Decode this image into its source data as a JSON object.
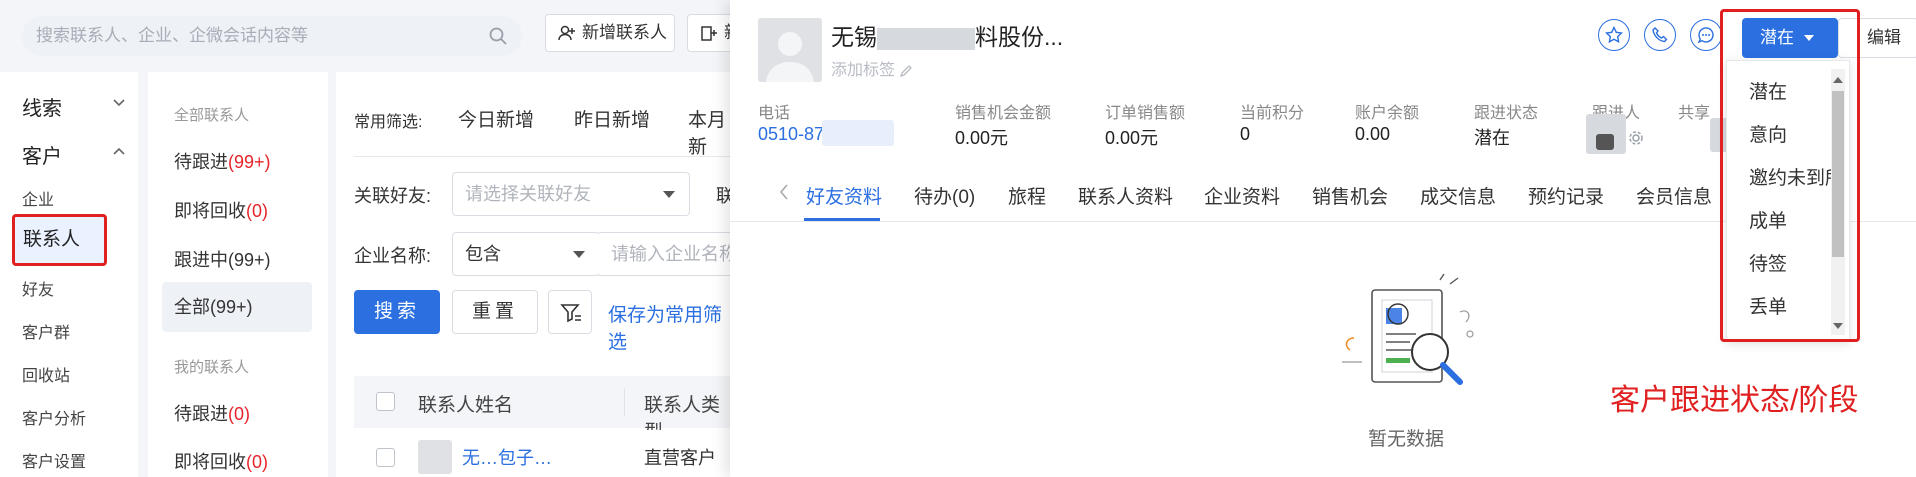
{
  "header": {
    "search_placeholder": "搜索联系人、企业、企微会话内容等",
    "new_contact_button": "新增联系人",
    "second_button_partial": "新"
  },
  "left_nav": {
    "sections": [
      {
        "label": "线索",
        "expanded": false
      },
      {
        "label": "客户",
        "expanded": true
      }
    ],
    "items": [
      "企业",
      "联系人",
      "好友",
      "客户群",
      "回收站",
      "客户分析",
      "客户设置"
    ],
    "active_item": "联系人"
  },
  "contact_groups": {
    "all_heading": "全部联系人",
    "all_items": [
      {
        "label": "待跟进",
        "count": "(99+)",
        "count_red": true
      },
      {
        "label": "即将回收",
        "count": "(0)",
        "count_red": true
      },
      {
        "label": "跟进中",
        "count": "(99+)",
        "count_red": false
      },
      {
        "label": "全部",
        "count": "(99+)",
        "count_red": false
      }
    ],
    "mine_heading": "我的联系人",
    "mine_items": [
      {
        "label": "待跟进",
        "count": "(0)",
        "count_red": true
      },
      {
        "label": "即将回收",
        "count": "(0)",
        "count_red": true
      }
    ]
  },
  "filters": {
    "quick_label": "常用筛选:",
    "quick_tabs": [
      "今日新增",
      "昨日新增",
      "本月新"
    ],
    "friend_label": "关联好友:",
    "friend_placeholder": "请选择关联好友",
    "friend_side_partial": "联",
    "company_label": "企业名称:",
    "company_operator": "包含",
    "company_placeholder": "请输入企业名称",
    "search_button": "搜索",
    "reset_button": "重置",
    "save_filter_link": "保存为常用筛选"
  },
  "table": {
    "columns": [
      "联系人姓名",
      "联系人类型"
    ],
    "rows": [
      {
        "name_partial": "无…包子…",
        "type": "直营客户"
      }
    ]
  },
  "drawer": {
    "company_name_start": "无锡",
    "company_name_end": "料股份...",
    "add_tag": "添加标签",
    "status_button": "潜在",
    "edit_button": "编辑",
    "stats": [
      {
        "label": "电话",
        "value": "0510-87          (5)",
        "blue": true
      },
      {
        "label": "销售机会金额",
        "value": "0.00元",
        "blue": false
      },
      {
        "label": "订单销售额",
        "value": "0.00元",
        "blue": false
      },
      {
        "label": "当前积分",
        "value": "0",
        "blue": false
      },
      {
        "label": "账户余额",
        "value": "0.00",
        "blue": false
      },
      {
        "label": "跟进状态",
        "value": "潜在",
        "blue": false
      },
      {
        "label": "跟进人",
        "value": "",
        "blue": false
      },
      {
        "label": "共享",
        "value": "",
        "blue": false
      }
    ],
    "tabs": [
      "好友资料",
      "待办(0)",
      "旅程",
      "联系人资料",
      "企业资料",
      "销售机会",
      "成交信息",
      "预约记录",
      "会员信息"
    ],
    "active_tab": "好友资料",
    "empty_text": "暂无数据"
  },
  "status_dropdown": {
    "options": [
      "潜在",
      "意向",
      "邀约未到所",
      "成单",
      "待签",
      "丢单"
    ]
  },
  "annotation": {
    "text": "客户跟进状态/阶段",
    "color": "#e02020"
  },
  "colors": {
    "primary": "#2b6fe0",
    "danger": "#e5252a"
  }
}
